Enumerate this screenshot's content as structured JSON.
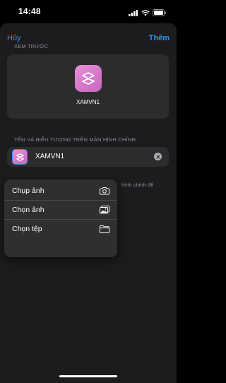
{
  "status_bar": {
    "time": "14:48"
  },
  "nav": {
    "cancel_label": "Hủy",
    "add_label": "Thêm"
  },
  "preview": {
    "section_label": "XEM TRƯỚC",
    "app_name": "XAMVN1"
  },
  "home_screen": {
    "section_label": "TÊN VÀ BIỂU TƯỢNG TRÊN MÀN HÌNH CHÍNH",
    "name_value": "XAMVN1",
    "hint_partial": "hình chính để"
  },
  "menu": {
    "items": [
      {
        "label": "Chụp ảnh",
        "icon": "camera-icon"
      },
      {
        "label": "Chọn ảnh",
        "icon": "photo-library-icon"
      },
      {
        "label": "Chọn tệp",
        "icon": "folder-icon"
      }
    ]
  },
  "colors": {
    "accent": "#3a8ee6",
    "icon_gradient_start": "#e98fd6",
    "icon_gradient_end": "#c766c0",
    "sheet_background": "#1c1c1e",
    "card_background": "#2c2c2e"
  }
}
